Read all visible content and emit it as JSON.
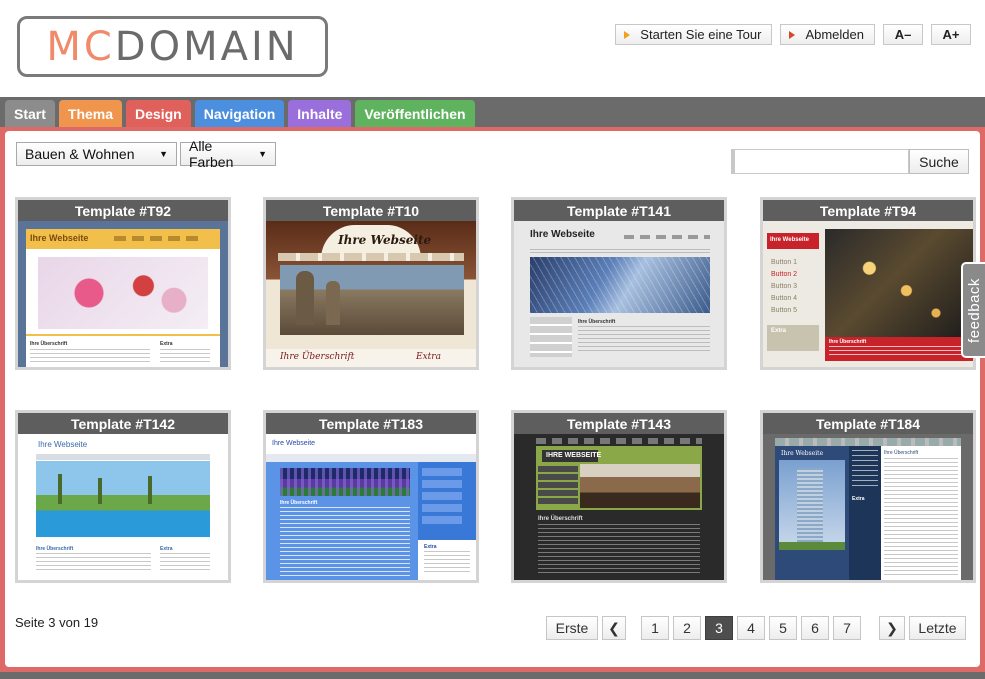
{
  "logo": {
    "mc": "Mc",
    "domain": "Domain"
  },
  "top_actions": {
    "tour": "Starten Sie eine Tour",
    "logout": "Abmelden",
    "font_smaller": "A–",
    "font_larger": "A+"
  },
  "tabs": [
    {
      "label": "Start",
      "color": "#8c8c8c"
    },
    {
      "label": "Thema",
      "color": "#f0954e"
    },
    {
      "label": "Design",
      "color": "#e0615c"
    },
    {
      "label": "Navigation",
      "color": "#4c8fde"
    },
    {
      "label": "Inhalte",
      "color": "#9a6fdc"
    },
    {
      "label": "Veröffentlichen",
      "color": "#5fb35f"
    }
  ],
  "filters": {
    "category": "Bauen & Wohnen",
    "colors": "Alle Farben"
  },
  "search": {
    "value": "",
    "button": "Suche"
  },
  "templates": [
    {
      "title": "Template #T92",
      "site_title": "Ihre Webseite",
      "heading": "Ihre Überschrift",
      "side_heading": "Extra"
    },
    {
      "title": "Template #T10",
      "site_title": "Ihre Webseite",
      "heading": "Ihre Überschrift",
      "side_heading": "Extra"
    },
    {
      "title": "Template #T141",
      "site_title": "Ihre Webseite",
      "heading": "Ihre Überschrift"
    },
    {
      "title": "Template #T94",
      "site_title": "Ihre Webseite",
      "heading": "Ihre Überschrift",
      "side_heading": "Extra",
      "menu": [
        "Button 1",
        "Button 2",
        "Button 3",
        "Button 4",
        "Button 5"
      ]
    },
    {
      "title": "Template #T142",
      "site_title": "Ihre Webseite",
      "heading": "Ihre Überschrift",
      "side_heading": "Extra"
    },
    {
      "title": "Template #T183",
      "site_title": "Ihre Webseite",
      "heading": "Ihre Überschrift",
      "side_heading": "Extra"
    },
    {
      "title": "Template #T143",
      "site_title": "IHRE WEBSEITE",
      "heading": "Ihre Überschrift"
    },
    {
      "title": "Template #T184",
      "site_title": "Ihre Webseite",
      "heading": "Ihre Überschrift",
      "side_heading": "Extra"
    }
  ],
  "pagination": {
    "info": "Seite 3 von 19",
    "first": "Erste",
    "prev": "❮",
    "pages": [
      "1",
      "2",
      "3",
      "4",
      "5",
      "6",
      "7"
    ],
    "current": "3",
    "next": "❯",
    "last": "Letzte"
  },
  "feedback": "feedback"
}
